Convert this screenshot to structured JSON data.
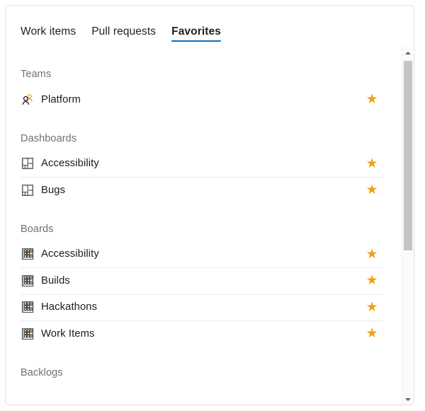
{
  "tabs": [
    {
      "label": "Work items",
      "active": false
    },
    {
      "label": "Pull requests",
      "active": false
    },
    {
      "label": "Favorites",
      "active": true
    }
  ],
  "accent_color": "#0f6cbd",
  "star_color": "#f2a118",
  "groups": [
    {
      "header": "Teams",
      "items": [
        {
          "label": "Platform",
          "icon": "team-people-icon",
          "star": "★"
        }
      ]
    },
    {
      "header": "Dashboards",
      "items": [
        {
          "label": "Accessibility",
          "icon": "dashboard-grid-icon",
          "star": "★"
        },
        {
          "label": "Bugs",
          "icon": "dashboard-grid-icon",
          "star": "★"
        }
      ]
    },
    {
      "header": "Boards",
      "items": [
        {
          "label": "Accessibility",
          "icon": "board-kanban-icon",
          "star": "★"
        },
        {
          "label": "Builds",
          "icon": "board-kanban-icon",
          "star": "★"
        },
        {
          "label": "Hackathons",
          "icon": "board-kanban-icon",
          "star": "★"
        },
        {
          "label": "Work Items",
          "icon": "board-kanban-icon",
          "star": "★"
        }
      ]
    },
    {
      "header": "Backlogs",
      "items": []
    }
  ],
  "scrollbar": {
    "up_arrow": "scroll-up-arrow-icon",
    "down_arrow": "scroll-down-arrow-icon"
  }
}
